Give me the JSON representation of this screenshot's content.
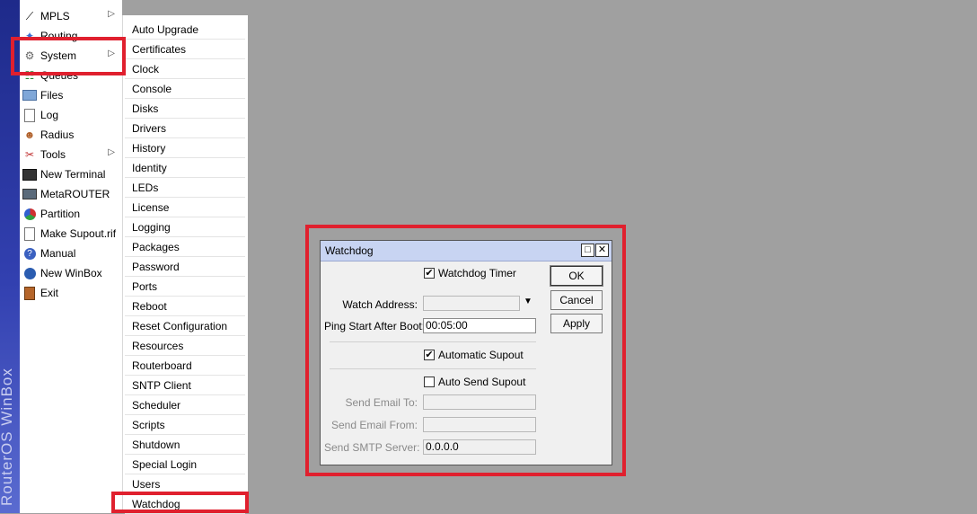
{
  "brand": {
    "text": "RouterOS WinBox"
  },
  "main_menu": {
    "items": [
      {
        "label": "MPLS",
        "icon": "mpls-icon",
        "submenu": true
      },
      {
        "label": "Routing",
        "icon": "routing-icon",
        "submenu": true
      },
      {
        "label": "System",
        "icon": "gear-icon",
        "submenu": true
      },
      {
        "label": "Queues",
        "icon": "queues-icon",
        "submenu": false
      },
      {
        "label": "Files",
        "icon": "folder-icon",
        "submenu": false
      },
      {
        "label": "Log",
        "icon": "log-icon",
        "submenu": false
      },
      {
        "label": "Radius",
        "icon": "radius-icon",
        "submenu": false
      },
      {
        "label": "Tools",
        "icon": "tools-icon",
        "submenu": true
      },
      {
        "label": "New Terminal",
        "icon": "terminal-icon",
        "submenu": false
      },
      {
        "label": "MetaROUTER",
        "icon": "metarouter-icon",
        "submenu": false
      },
      {
        "label": "Partition",
        "icon": "partition-icon",
        "submenu": false
      },
      {
        "label": "Make Supout.rif",
        "icon": "supout-icon",
        "submenu": false
      },
      {
        "label": "Manual",
        "icon": "help-icon",
        "submenu": false
      },
      {
        "label": "New WinBox",
        "icon": "winbox-icon",
        "submenu": false
      },
      {
        "label": "Exit",
        "icon": "exit-icon",
        "submenu": false
      }
    ],
    "selected": "System"
  },
  "system_submenu": {
    "items": [
      "Auto Upgrade",
      "Certificates",
      "Clock",
      "Console",
      "Disks",
      "Drivers",
      "History",
      "Identity",
      "LEDs",
      "License",
      "Logging",
      "Packages",
      "Password",
      "Ports",
      "Reboot",
      "Reset Configuration",
      "Resources",
      "Routerboard",
      "SNTP Client",
      "Scheduler",
      "Scripts",
      "Shutdown",
      "Special Login",
      "Users",
      "Watchdog"
    ],
    "selected": "Watchdog"
  },
  "dialog": {
    "title": "Watchdog",
    "restore_glyph": "□",
    "close_glyph": "✕",
    "watchdog_timer": {
      "label": "Watchdog Timer",
      "checked": true
    },
    "watch_address": {
      "label": "Watch Address:",
      "value": ""
    },
    "ping_start_after_boot": {
      "label": "Ping Start After Boot:",
      "value": "00:05:00"
    },
    "automatic_supout": {
      "label": "Automatic Supout",
      "checked": true
    },
    "auto_send_supout": {
      "label": "Auto Send Supout",
      "checked": false
    },
    "send_email_to": {
      "label": "Send Email To:",
      "value": ""
    },
    "send_email_from": {
      "label": "Send Email From:",
      "value": ""
    },
    "send_smtp_server": {
      "label": "Send SMTP Server:",
      "value": "0.0.0.0"
    },
    "buttons": {
      "ok": "OK",
      "cancel": "Cancel",
      "apply": "Apply"
    },
    "check_glyph": "✔",
    "dropdown_glyph": "▼"
  },
  "colors": {
    "highlight": "#e0202e",
    "brand_strip": "#2a36a0",
    "title_bar": "#c8d4f2",
    "desktop": "#a0a0a0"
  }
}
